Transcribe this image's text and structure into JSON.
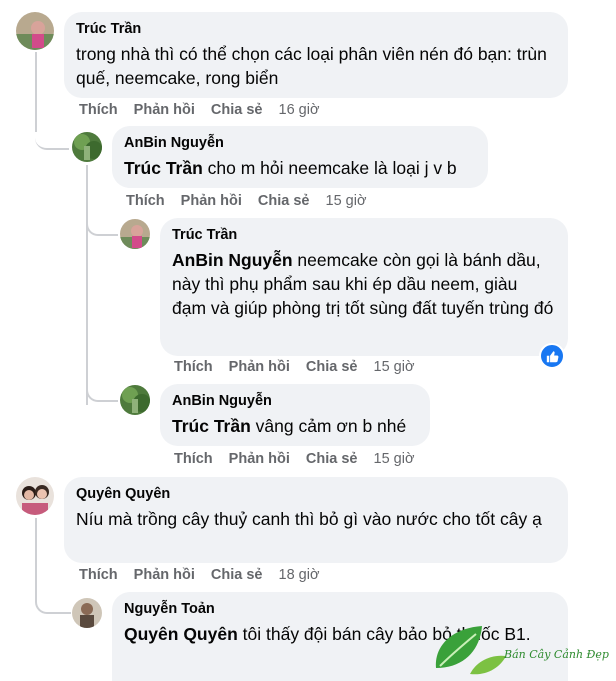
{
  "comments": [
    {
      "author": "Trúc Trần",
      "mention": "",
      "text": "trong nhà thì có thể chọn các loại phân viên nén đó bạn: trùn quế, neemcake, rong biển",
      "actions": {
        "like": "Thích",
        "reply": "Phản hồi",
        "share": "Chia sẻ",
        "time": "16 giờ"
      }
    },
    {
      "author": "AnBin Nguyễn",
      "mention": "Trúc Trần",
      "text": " cho m hỏi neemcake là loại j v b",
      "actions": {
        "like": "Thích",
        "reply": "Phản hồi",
        "share": "Chia sẻ",
        "time": "15 giờ"
      }
    },
    {
      "author": "Trúc Trần",
      "mention": "AnBin Nguyễn",
      "text": " neemcake còn gọi là bánh dầu, này thì phụ phẩm sau khi ép dầu neem, giàu đạm và giúp phòng trị tốt sùng đất tuyến trùng đó",
      "actions": {
        "like": "Thích",
        "reply": "Phản hồi",
        "share": "Chia sẻ",
        "time": "15 giờ"
      }
    },
    {
      "author": "AnBin Nguyễn",
      "mention": "Trúc Trần",
      "text": " vâng cảm ơn b nhé",
      "actions": {
        "like": "Thích",
        "reply": "Phản hồi",
        "share": "Chia sẻ",
        "time": "15 giờ"
      }
    },
    {
      "author": "Quyên Quyên",
      "mention": "",
      "text": "Níu mà trồng cây thuỷ canh thì bỏ gì vào nước cho tốt cây ạ",
      "actions": {
        "like": "Thích",
        "reply": "Phản hồi",
        "share": "Chia sẻ",
        "time": "18 giờ"
      }
    },
    {
      "author": "Nguyễn Toản",
      "mention": "Quyên Quyên",
      "text": " tôi thấy đội bán cây bảo bỏ thuốc B1.",
      "actions": {}
    }
  ],
  "reaction_icon": "like-icon",
  "watermark": {
    "text": "Bán Cây Cảnh Đẹp",
    "icon": "leaf-logo"
  },
  "colors": {
    "bubble": "#f0f2f5",
    "meta": "#65676b",
    "like": "#1877f2",
    "thread_line": "#ced0d4"
  }
}
